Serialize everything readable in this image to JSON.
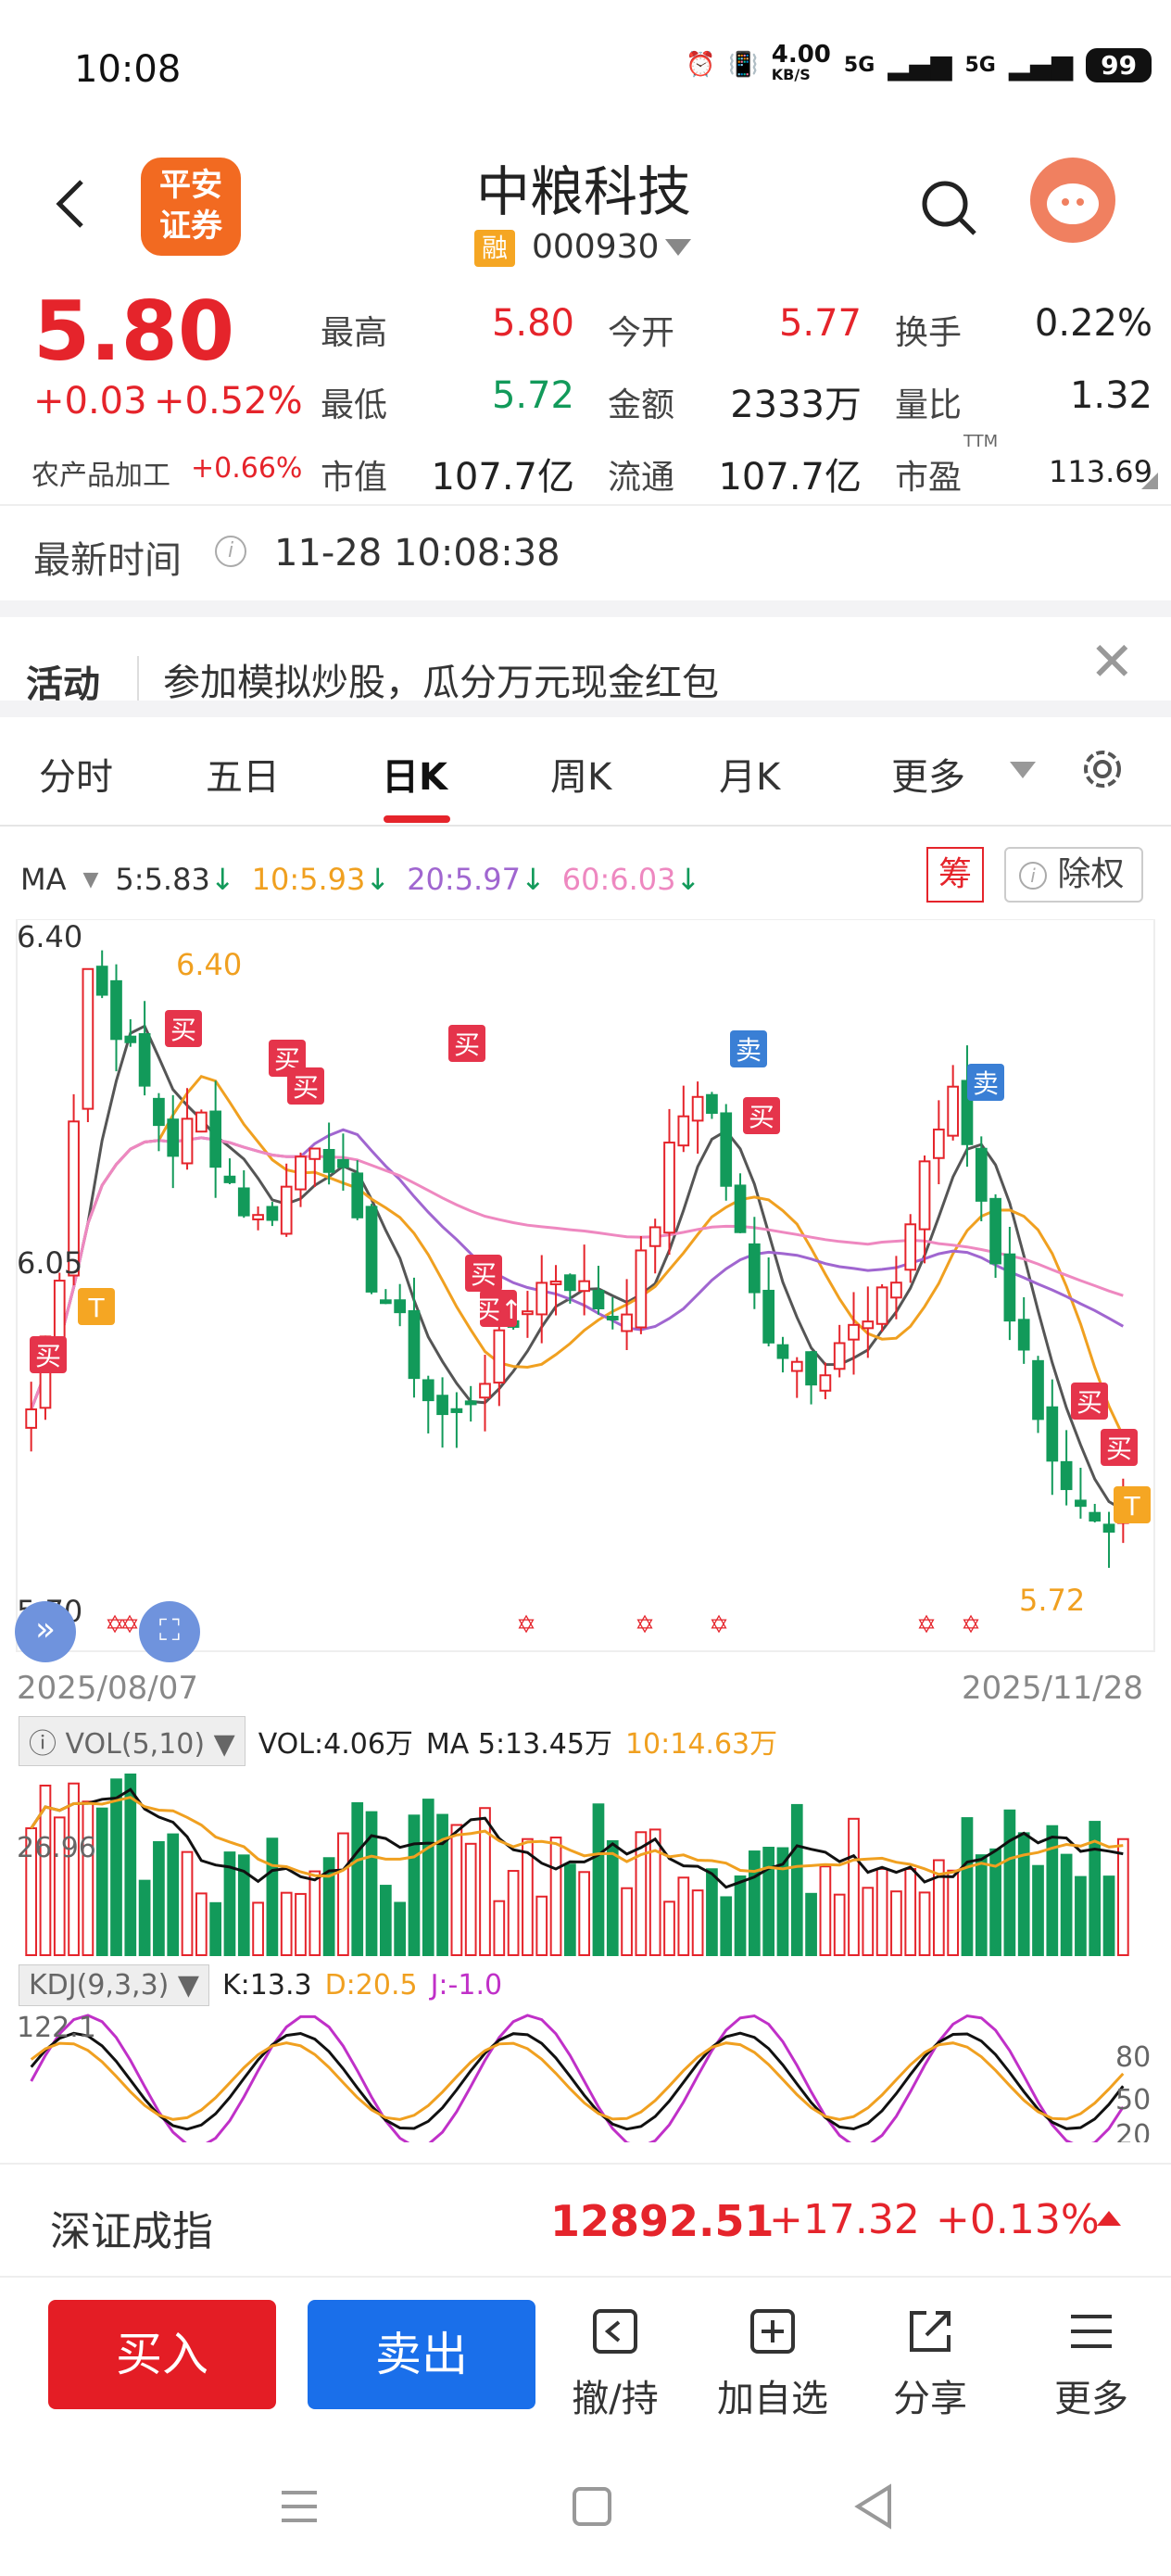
{
  "status_bar": {
    "time": "10:08",
    "net_speed": "4.00",
    "net_unit": "KB/S",
    "sig1": "5G",
    "sig2": "5G",
    "battery": "99"
  },
  "header": {
    "logo_line1": "平安",
    "logo_line2": "证券",
    "stock_name": "中粮科技",
    "rong_badge": "融",
    "stock_code": "000930"
  },
  "quote": {
    "price": "5.80",
    "change": "+0.03",
    "change_pct": "+0.52%",
    "industry": "农产品加工",
    "industry_pct": "+0.66%",
    "labels": {
      "high": "最高",
      "low": "最低",
      "mcap": "市值",
      "open": "今开",
      "amount": "金额",
      "float": "流通",
      "turnover": "换手",
      "vol_ratio": "量比",
      "pe": "市盈",
      "ttm": "TTM"
    },
    "values": {
      "high": "5.80",
      "low": "5.72",
      "mcap": "107.7亿",
      "open": "5.77",
      "amount": "2333万",
      "float": "107.7亿",
      "turnover": "0.22%",
      "vol_ratio": "1.32",
      "pe": "113.69"
    }
  },
  "latest_time": {
    "label": "最新时间",
    "info": "i",
    "value": "11-28 10:08:38"
  },
  "activity": {
    "label": "活动",
    "text": "参加模拟炒股，瓜分万元现金红包",
    "close": "✕"
  },
  "tabs": [
    {
      "key": "fenshi",
      "label": "分时"
    },
    {
      "key": "wuri",
      "label": "五日"
    },
    {
      "key": "rik",
      "label": "日K"
    },
    {
      "key": "zhouk",
      "label": "周K"
    },
    {
      "key": "yuek",
      "label": "月K"
    },
    {
      "key": "more",
      "label": "更多"
    }
  ],
  "ma_legend": {
    "name": "MA",
    "ma5": "5:5.83",
    "ma10": "10:5.93",
    "ma20": "20:5.97",
    "ma60": "60:6.03",
    "arrow": "↓"
  },
  "chart_buttons": {
    "chou": "筹",
    "chuquan": "除权"
  },
  "colors": {
    "red": "#e5242b",
    "green": "#129a5a",
    "ma5": "#555555",
    "ma10": "#f0a020",
    "ma20": "#a066d0",
    "ma60": "#ee88c0",
    "buy_tag": "#e5344b",
    "sell_tag": "#3a7fd5",
    "t_tag": "#f5a623",
    "buy_button": "#e41d25",
    "sell_button": "#1a6fea"
  },
  "chart_data": {
    "type": "candlestick",
    "x_start": "2025/08/07",
    "x_end": "2025/11/28",
    "y_ticks": [
      "6.40",
      "6.05",
      "5.70"
    ],
    "ylim": [
      5.7,
      6.4
    ],
    "max_label": "6.40",
    "min_label": "5.72",
    "markers": [
      {
        "label": "买",
        "type": "buy"
      },
      {
        "label": "T",
        "type": "t"
      },
      {
        "label": "买",
        "type": "buy"
      },
      {
        "label": "买",
        "type": "buy"
      },
      {
        "label": "买",
        "type": "buy"
      },
      {
        "label": "买",
        "type": "buy"
      },
      {
        "label": "买",
        "type": "buy"
      },
      {
        "label": "买↑",
        "type": "buy"
      },
      {
        "label": "卖",
        "type": "sell"
      },
      {
        "label": "买",
        "type": "buy"
      },
      {
        "label": "卖",
        "type": "sell"
      },
      {
        "label": "买",
        "type": "buy"
      },
      {
        "label": "买",
        "type": "buy"
      },
      {
        "label": "T",
        "type": "t"
      }
    ],
    "volume": {
      "indicator": "VOL(5,10)",
      "vol": "VOL:4.06万",
      "ma5": "MA 5:13.45万",
      "ma10": "10:14.63万",
      "y_tick": "26.96"
    },
    "kdj": {
      "indicator": "KDJ(9,3,3)",
      "k": "K:13.3",
      "d": "D:20.5",
      "j": "J:-1.0",
      "y_ticks": [
        "122.1",
        "80",
        "50",
        "20"
      ]
    }
  },
  "index_bar": {
    "name": "深证成指",
    "value": "12892.51",
    "change": "+17.32",
    "change_pct": "+0.13%"
  },
  "actions": {
    "buy": "买入",
    "sell": "卖出",
    "cancel": "撤/持",
    "add_fav": "加自选",
    "share": "分享",
    "more": "更多"
  }
}
